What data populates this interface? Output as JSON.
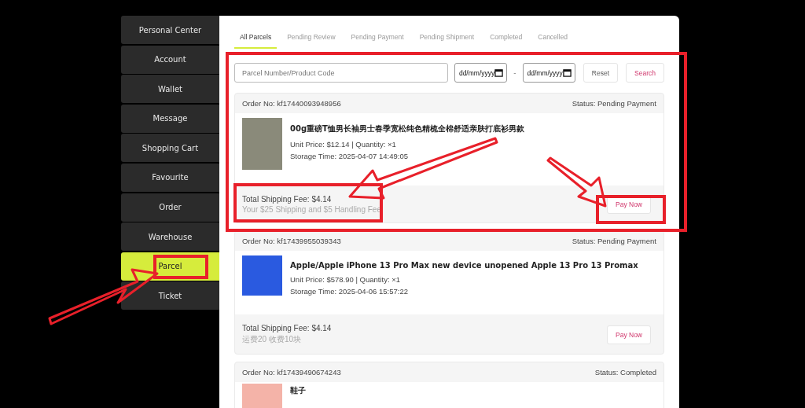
{
  "sidebar": {
    "items": [
      {
        "label": "Personal Center",
        "selected": false
      },
      {
        "label": "Account",
        "selected": false
      },
      {
        "label": "Wallet",
        "selected": false
      },
      {
        "label": "Message",
        "selected": false
      },
      {
        "label": "Shopping Cart",
        "selected": false
      },
      {
        "label": "Favourite",
        "selected": false
      },
      {
        "label": "Order",
        "selected": false
      },
      {
        "label": "Warehouse",
        "selected": false
      },
      {
        "label": "Parcel",
        "selected": true
      },
      {
        "label": "Ticket",
        "selected": false
      }
    ]
  },
  "tabs": [
    {
      "label": "All Parcels",
      "selected": true
    },
    {
      "label": "Pending Review",
      "selected": false
    },
    {
      "label": "Pending Payment",
      "selected": false
    },
    {
      "label": "Pending Shipment",
      "selected": false
    },
    {
      "label": "Completed",
      "selected": false
    },
    {
      "label": "Cancelled",
      "selected": false
    }
  ],
  "filter": {
    "search": {
      "placeholder": "Parcel Number/Product Code"
    },
    "date_from": {
      "placeholder": "dd/mm/yyyy"
    },
    "separator": "-",
    "date_to": {
      "placeholder": "dd/mm/yyyy"
    },
    "buttons": [
      "Reset",
      "Search"
    ]
  },
  "parcels": [
    {
      "order_no": "Order No: kf17440093948956",
      "status": "Status: Pending Payment",
      "title": "00g重磅T恤男长袖男士春季宽松纯色精梳全棉舒适亲肤打底衫男款",
      "unit_price": "Unit Price: $12.14 | Quantity: ×1",
      "storage_time": "Storage Time: 2025-04-07 14:49:05",
      "shipping_fee": "Total Shipping Fee: $4.14",
      "fee_note": "Your $25 Shipping and $5 Handling Fee",
      "action": "Pay Now"
    },
    {
      "order_no": "Order No: kf17439955039343",
      "status": "Status: Pending Payment",
      "title": "Apple/Apple iPhone 13 Pro Max new device unopened Apple 13 Pro 13 Promax",
      "unit_price": "Unit Price: $578.90 | Quantity: ×1",
      "storage_time": "Storage Time: 2025-04-06 15:57:22",
      "shipping_fee": "Total Shipping Fee: $4.14",
      "fee_note": "运费20 收费10块",
      "action": "Pay Now"
    },
    {
      "order_no": "Order No: kf17439490674243",
      "status": "Status: Completed",
      "title": "鞋子"
    }
  ]
}
